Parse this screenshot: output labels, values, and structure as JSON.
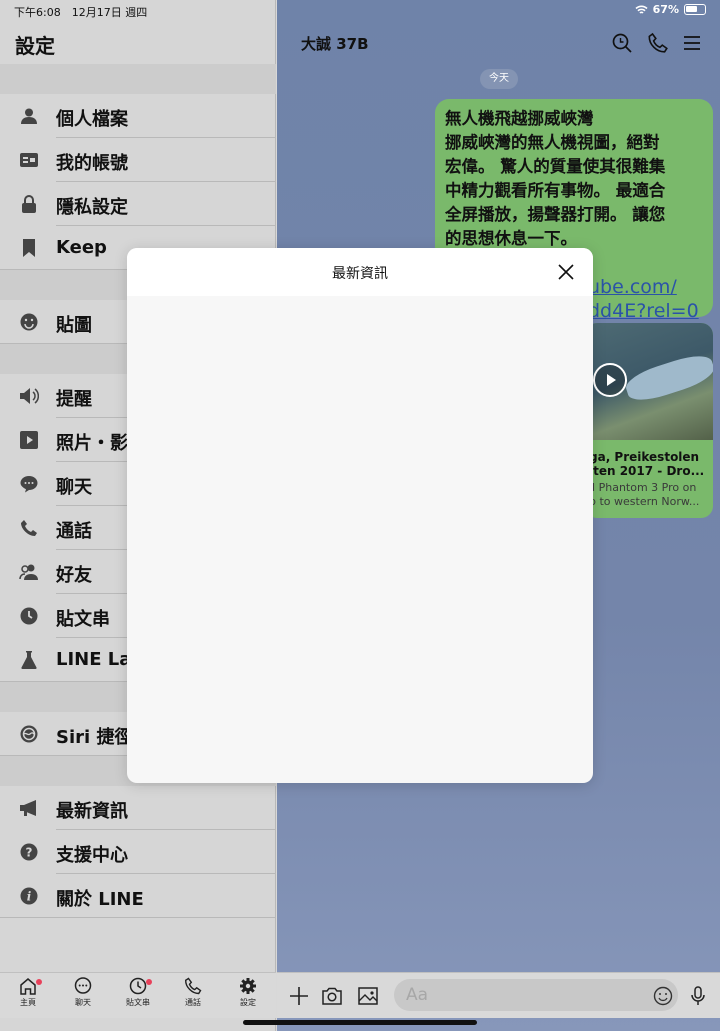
{
  "status": {
    "time": "下午6:08　12月17日 週四",
    "battery": "67%"
  },
  "settings": {
    "title": "設定",
    "groups": [
      [
        "個人檔案",
        "我的帳號",
        "隱私設定",
        "Keep"
      ],
      [
        "貼圖"
      ],
      [
        "提醒",
        "照片・影",
        "聊天",
        "通話",
        "好友",
        "貼文串",
        "LINE Lab"
      ],
      [
        "Siri 捷徑"
      ],
      [
        "最新資訊",
        "支援中心",
        "關於 LINE"
      ]
    ]
  },
  "tabs": [
    {
      "label": "主頁",
      "icon": "home-icon",
      "badge": true
    },
    {
      "label": "聊天",
      "icon": "chat-icon",
      "badge": false
    },
    {
      "label": "貼文串",
      "icon": "clock-icon",
      "badge": true
    },
    {
      "label": "通話",
      "icon": "phone-icon",
      "badge": false
    },
    {
      "label": "設定",
      "icon": "gear-icon",
      "badge": false
    }
  ],
  "chat": {
    "title": "大誠 37B",
    "date": "今天",
    "message_lines": [
      "無人機飛越挪威峽灣",
      "挪威峽灣的無人機視圖，絕對",
      "宏偉。 驚人的質量使其很難集",
      "中精力觀看所有事物。 最適合",
      "全屏播放，揚聲器打開。 讓您",
      "的思想休息一下。"
    ],
    "link_lines": [
      "ube.com/",
      "dd4E?rel=0"
    ],
    "card": {
      "title_line1": "ga, Preikestolen",
      "title_line2": "lten 2017 - Dro...",
      "desc_line1": "ll Phantom 3 Pro on",
      "desc_line2": "p to western Norw..."
    },
    "input_placeholder": "Aa"
  },
  "modal": {
    "title": "最新資訊"
  },
  "colors": {
    "accent_green": "#7ab96b",
    "chat_bg": "#7485aa",
    "badge_red": "#e8415a",
    "link_blue": "#2b53a8"
  }
}
